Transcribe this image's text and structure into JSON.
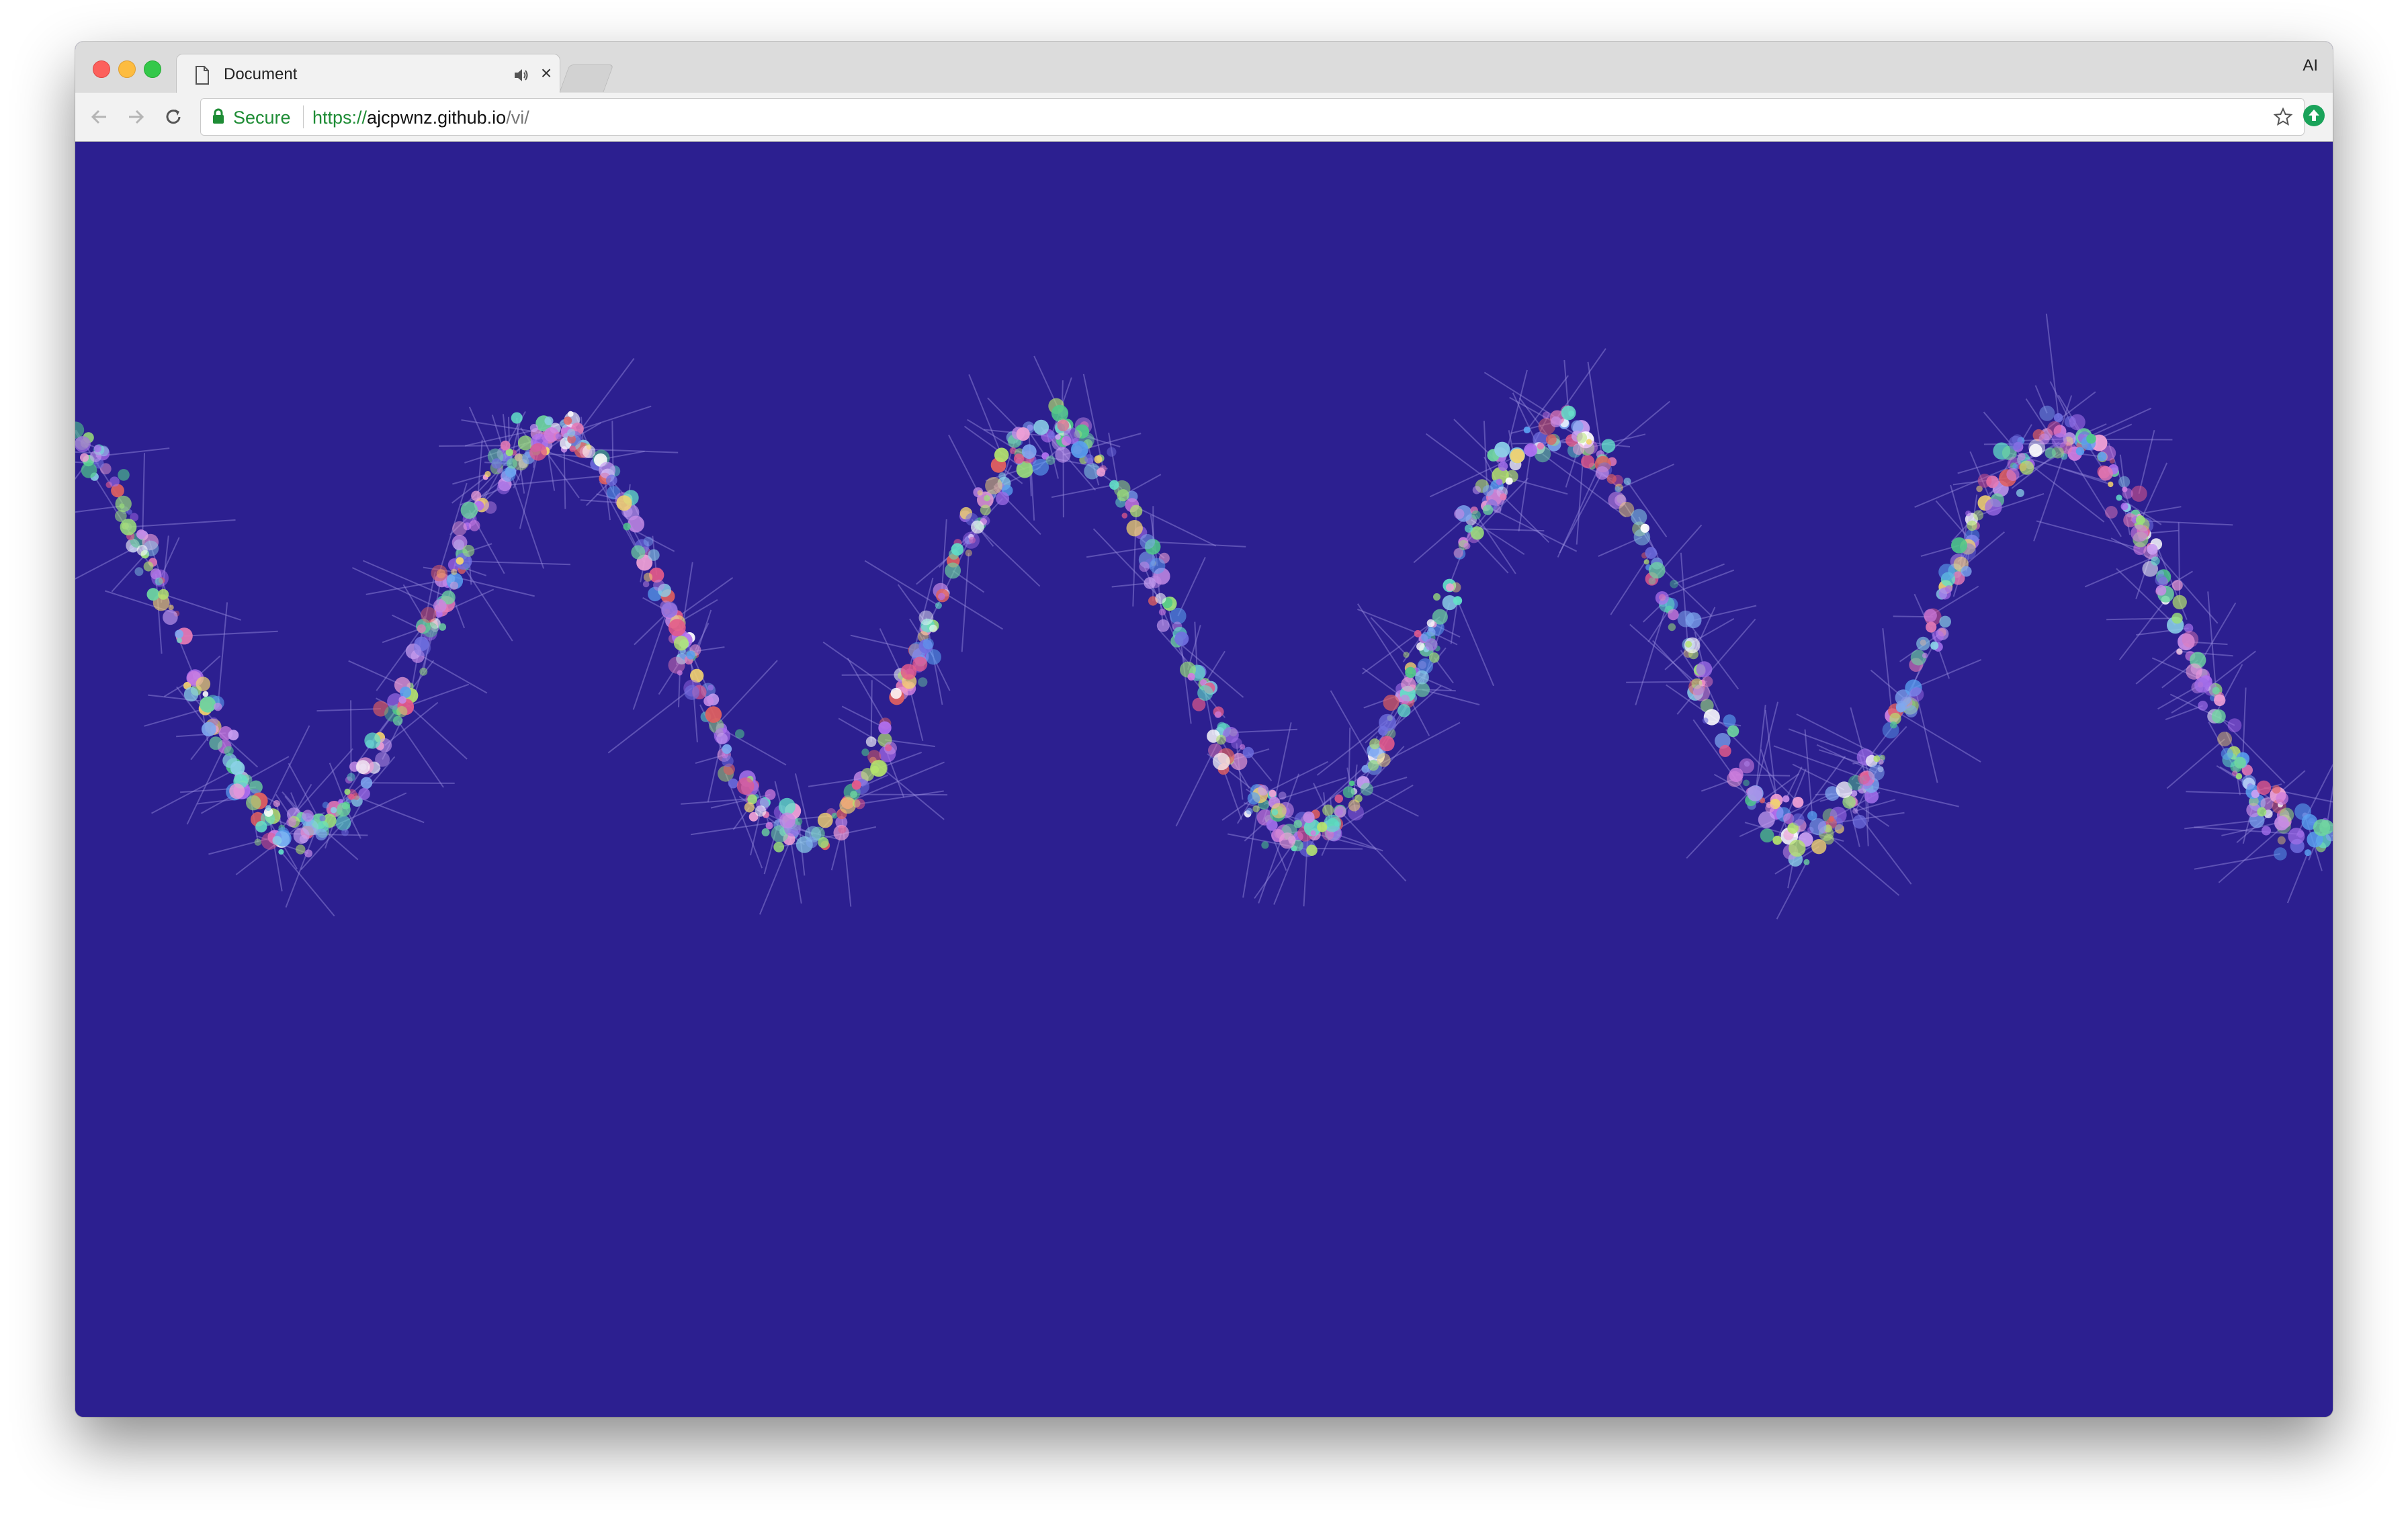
{
  "browser": {
    "tab_title": "Document",
    "profile_label": "AI",
    "secure_label": "Secure",
    "url_scheme": "https://",
    "url_host": "ajcpwnz.github.io",
    "url_path": "/vi/"
  },
  "icons": {
    "tab": [
      "document-icon",
      "speaker-icon",
      "close-icon"
    ],
    "toolbar": [
      "back-arrow-icon",
      "forward-arrow-icon",
      "reload-icon",
      "lock-icon",
      "star-icon",
      "extension-icon"
    ]
  },
  "colors": {
    "canvas_background": "#2c1f90",
    "secure_green": "#1e8c35",
    "extension_green": "#1aa35a"
  },
  "visualization": {
    "description_type": "particle-wave",
    "waves": 4.5,
    "particle_count": 1200
  }
}
